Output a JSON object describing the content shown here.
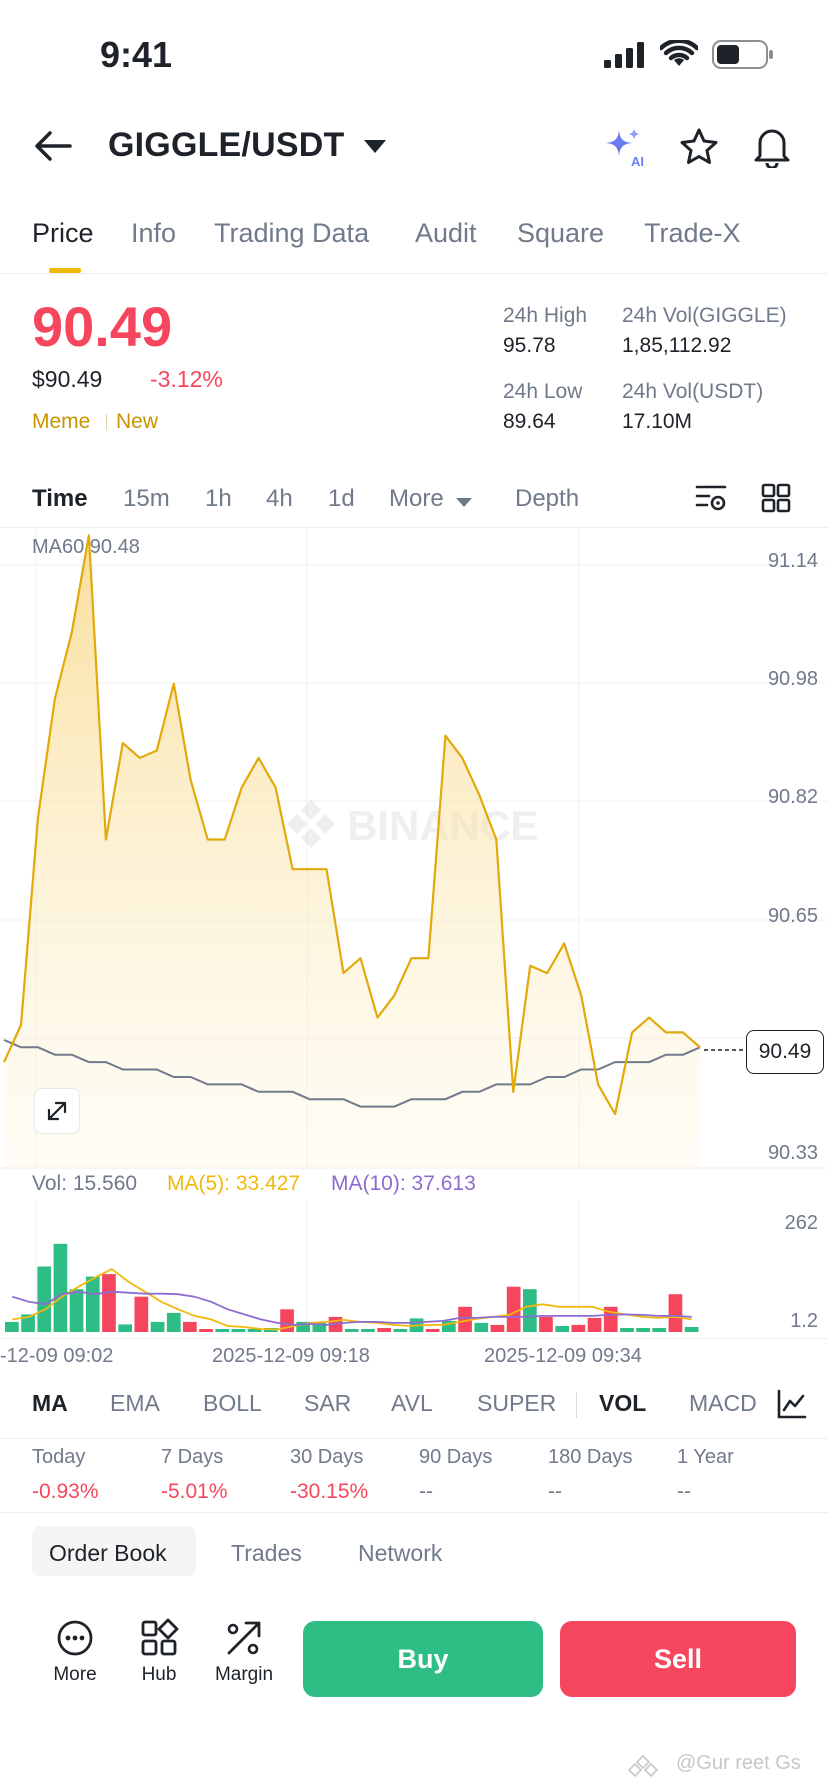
{
  "status": {
    "time": "9:41"
  },
  "header": {
    "pair": "GIGGLE/USDT"
  },
  "tabs": [
    "Price",
    "Info",
    "Trading Data",
    "Audit",
    "Square",
    "Trade-X"
  ],
  "price": {
    "last": "90.49",
    "usd": "$90.49",
    "change": "-3.12%",
    "tags": [
      "Meme",
      "New"
    ]
  },
  "stats": {
    "high_label": "24h High",
    "high": "95.78",
    "low_label": "24h Low",
    "low": "89.64",
    "vol_base_label": "24h Vol(GIGGLE)",
    "vol_base": "1,85,112.92",
    "vol_quote_label": "24h Vol(USDT)",
    "vol_quote": "17.10M"
  },
  "timeframes": [
    "Time",
    "15m",
    "1h",
    "4h",
    "1d",
    "More",
    "Depth"
  ],
  "chart": {
    "ma60_label": "MA60 90.48",
    "watermark": "BINANCE",
    "price_axis": [
      "91.14",
      "90.98",
      "90.82",
      "90.65",
      "90.33"
    ],
    "current_tag": "90.49",
    "vol_label": "Vol: 15.560",
    "ma5_label": "MA(5): 33.427",
    "ma10_label": "MA(10): 37.613",
    "vol_axis": [
      "262",
      "1.2"
    ],
    "time_labels": [
      "-12-09 09:02",
      "2025-12-09 09:18",
      "2025-12-09 09:34"
    ],
    "colors": {
      "line": "#e2a90b",
      "ma": "#707a8a",
      "up": "#2ebd85",
      "down": "#f6465d",
      "ma5": "#f0b90b",
      "ma10": "#8e6bd1"
    }
  },
  "chart_data": {
    "type": "line",
    "title": "",
    "xlabel": "",
    "ylabel": "",
    "x_labels": [
      "09:02",
      "09:18",
      "09:34"
    ],
    "ylim": [
      90.33,
      91.14
    ],
    "series": [
      {
        "values": [
          90.47,
          90.52,
          90.8,
          90.96,
          91.05,
          91.18,
          90.77,
          90.9,
          90.88,
          90.89,
          90.98,
          90.85,
          90.77,
          90.77,
          90.84,
          90.88,
          90.84,
          90.73,
          90.73,
          90.73,
          90.59,
          90.61,
          90.53,
          90.56,
          90.61,
          90.61,
          90.91,
          90.88,
          90.83,
          90.77,
          90.43,
          90.6,
          90.59,
          90.63,
          90.56,
          90.44,
          90.4,
          90.51,
          90.53,
          90.51,
          90.51,
          90.49
        ]
      },
      {
        "values": [
          90.5,
          90.49,
          90.49,
          90.48,
          90.48,
          90.47,
          90.47,
          90.46,
          90.46,
          90.46,
          90.45,
          90.45,
          90.44,
          90.44,
          90.44,
          90.43,
          90.43,
          90.43,
          90.42,
          90.42,
          90.42,
          90.41,
          90.41,
          90.41,
          90.42,
          90.42,
          90.42,
          90.43,
          90.43,
          90.44,
          90.44,
          90.44,
          90.45,
          90.45,
          90.46,
          90.46,
          90.47,
          90.47,
          90.47,
          90.48,
          90.48,
          90.49
        ]
      }
    ],
    "volume": {
      "ylim": [
        0,
        262
      ],
      "bars": [
        {
          "v": 20,
          "up": true
        },
        {
          "v": 35,
          "up": true
        },
        {
          "v": 130,
          "up": true
        },
        {
          "v": 175,
          "up": true
        },
        {
          "v": 85,
          "up": true
        },
        {
          "v": 110,
          "up": true
        },
        {
          "v": 115,
          "up": false
        },
        {
          "v": 15,
          "up": true
        },
        {
          "v": 70,
          "up": false
        },
        {
          "v": 20,
          "up": true
        },
        {
          "v": 38,
          "up": true
        },
        {
          "v": 20,
          "up": false
        },
        {
          "v": 5,
          "up": false
        },
        {
          "v": 4,
          "up": true
        },
        {
          "v": 4,
          "up": true
        },
        {
          "v": 4,
          "up": true
        },
        {
          "v": 8,
          "up": true
        },
        {
          "v": 45,
          "up": false
        },
        {
          "v": 20,
          "up": true
        },
        {
          "v": 18,
          "up": true
        },
        {
          "v": 30,
          "up": false
        },
        {
          "v": 4,
          "up": true
        },
        {
          "v": 5,
          "up": true
        },
        {
          "v": 8,
          "up": false
        },
        {
          "v": 3,
          "up": true
        },
        {
          "v": 27,
          "up": true
        },
        {
          "v": 6,
          "up": false
        },
        {
          "v": 22,
          "up": true
        },
        {
          "v": 50,
          "up": false
        },
        {
          "v": 18,
          "up": true
        },
        {
          "v": 14,
          "up": false
        },
        {
          "v": 90,
          "up": false
        },
        {
          "v": 85,
          "up": true
        },
        {
          "v": 30,
          "up": false
        },
        {
          "v": 12,
          "up": true
        },
        {
          "v": 14,
          "up": false
        },
        {
          "v": 28,
          "up": false
        },
        {
          "v": 50,
          "up": false
        },
        {
          "v": 8,
          "up": true
        },
        {
          "v": 8,
          "up": true
        },
        {
          "v": 8,
          "up": true
        },
        {
          "v": 75,
          "up": false
        },
        {
          "v": 10,
          "up": true
        }
      ],
      "ma5": [
        25,
        30,
        45,
        70,
        90,
        108,
        125,
        100,
        80,
        60,
        45,
        32,
        25,
        12,
        10,
        6,
        5,
        12,
        18,
        20,
        24,
        20,
        18,
        14,
        12,
        14,
        14,
        20,
        26,
        30,
        34,
        50,
        55,
        50,
        50,
        50,
        40,
        35,
        30,
        28,
        30,
        25
      ],
      "ma10": [
        70,
        60,
        55,
        75,
        80,
        75,
        80,
        78,
        76,
        76,
        75,
        70,
        60,
        45,
        35,
        25,
        18,
        14,
        16,
        14,
        18,
        20,
        20,
        18,
        18,
        20,
        22,
        28,
        28,
        30,
        30,
        30,
        32,
        32,
        32,
        32,
        34,
        35,
        34,
        32,
        32,
        30
      ]
    }
  },
  "indicators": [
    "MA",
    "EMA",
    "BOLL",
    "SAR",
    "AVL",
    "SUPER",
    "VOL",
    "MACD"
  ],
  "performance": [
    {
      "label": "Today",
      "value": "-0.93%"
    },
    {
      "label": "7 Days",
      "value": "-5.01%"
    },
    {
      "label": "30 Days",
      "value": "-30.15%"
    },
    {
      "label": "90 Days",
      "value": "--"
    },
    {
      "label": "180 Days",
      "value": "--"
    },
    {
      "label": "1 Year",
      "value": "--"
    }
  ],
  "sub_tabs": [
    "Order Book",
    "Trades",
    "Network"
  ],
  "bottom": {
    "more": "More",
    "hub": "Hub",
    "margin": "Margin",
    "buy": "Buy",
    "sell": "Sell"
  },
  "watermark": "@Gur  reet Gs"
}
